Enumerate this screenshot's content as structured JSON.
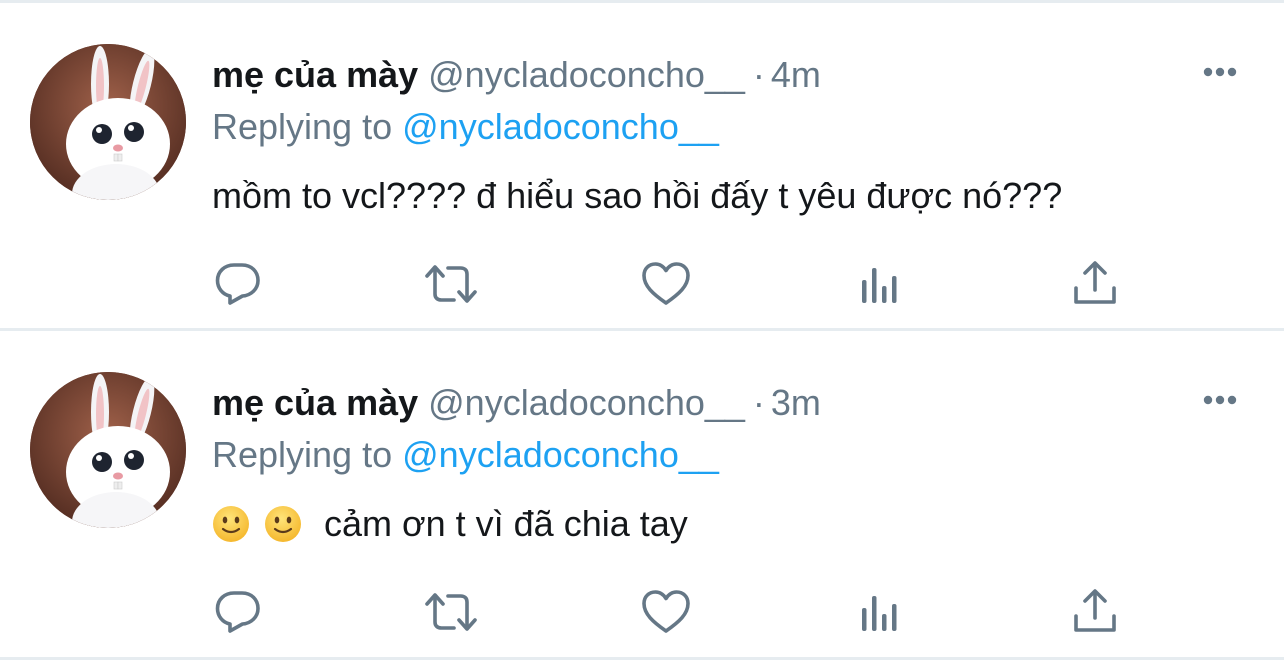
{
  "colors": {
    "text": "#14171a",
    "secondary": "#657786",
    "link": "#1da1f2",
    "divider": "#e6ecf0",
    "icon": "#657786"
  },
  "tweets": [
    {
      "display_name": "mẹ của mày",
      "handle": "@nycladoconcho__",
      "separator": "·",
      "time": "4m",
      "replying_prefix": "Replying to",
      "replying_handle": "@nycladoconcho__",
      "text": "mồm to vcl???? đ hiểu sao hồi đấy t yêu được nó???",
      "emojis": [],
      "icons": [
        "reply-icon",
        "retweet-icon",
        "like-icon",
        "analytics-icon",
        "share-icon"
      ]
    },
    {
      "display_name": "mẹ của mày",
      "handle": "@nycladoconcho__",
      "separator": "·",
      "time": "3m",
      "replying_prefix": "Replying to",
      "replying_handle": "@nycladoconcho__",
      "text": "cảm ơn t vì đã chia tay",
      "emojis": [
        "slightly-smiling-face",
        "slightly-smiling-face"
      ],
      "icons": [
        "reply-icon",
        "retweet-icon",
        "like-icon",
        "analytics-icon",
        "share-icon"
      ]
    }
  ]
}
